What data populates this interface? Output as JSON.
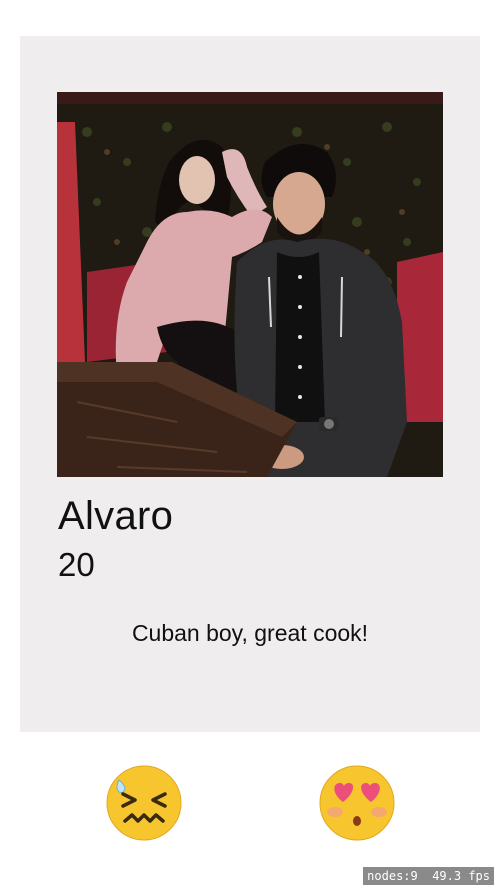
{
  "profile": {
    "name": "Alvaro",
    "age": "20",
    "bio": "Cuban boy, great cook!"
  },
  "actions": {
    "dislike_icon": "confounded-face-emoji",
    "like_icon": "heart-eyes-face-emoji"
  },
  "debug": {
    "nodes": "nodes:9",
    "fps": "49.3 fps"
  },
  "colors": {
    "card_background": "#efedee",
    "emoji_yellow": "#f7c62f",
    "heart_pink": "#ec4f7a"
  }
}
